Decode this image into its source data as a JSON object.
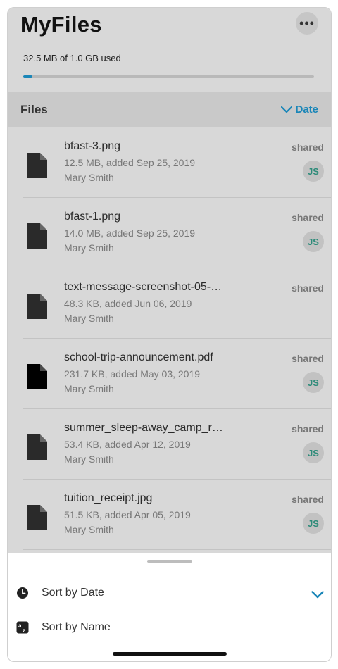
{
  "app": {
    "title": "MyFiles",
    "more_label": "•••"
  },
  "storage": {
    "usage_text": "32.5 MB of 1.0 GB used",
    "used_fraction": 0.032
  },
  "files_header": {
    "label": "Files",
    "sort_label": "Date"
  },
  "files": [
    {
      "name": "bfast-3.png",
      "meta": "12.5 MB, added Sep 25, 2019",
      "owner": "Mary Smith",
      "status": "shared",
      "avatar": "JS",
      "icon": "document-icon"
    },
    {
      "name": "bfast-1.png",
      "meta": "14.0 MB, added Sep 25, 2019",
      "owner": "Mary Smith",
      "status": "shared",
      "avatar": "JS",
      "icon": "document-icon"
    },
    {
      "name": "text-message-screenshot-05-…",
      "meta": "48.3 KB, added Jun 06, 2019",
      "owner": "Mary Smith",
      "status": "shared",
      "avatar": "",
      "icon": "document-icon"
    },
    {
      "name": "school-trip-announcement.pdf",
      "meta": "231.7 KB, added May 03, 2019",
      "owner": "Mary Smith",
      "status": "shared",
      "avatar": "JS",
      "icon": "document-icon"
    },
    {
      "name": "summer_sleep-away_camp_r…",
      "meta": "53.4 KB, added Apr 12, 2019",
      "owner": "Mary Smith",
      "status": "shared",
      "avatar": "JS",
      "icon": "document-icon"
    },
    {
      "name": "tuition_receipt.jpg",
      "meta": "51.5 KB, added Apr 05, 2019",
      "owner": "Mary Smith",
      "status": "shared",
      "avatar": "JS",
      "icon": "document-icon"
    }
  ],
  "sort_sheet": {
    "options": [
      {
        "label": "Sort by Date",
        "icon": "clock-icon",
        "selected": true
      },
      {
        "label": "Sort by Name",
        "icon": "alphabetical-sort-icon",
        "selected": false
      }
    ]
  },
  "colors": {
    "accent": "#1a86b8",
    "avatar_text": "#2d8b79",
    "overlay": "#d8d8d8"
  }
}
